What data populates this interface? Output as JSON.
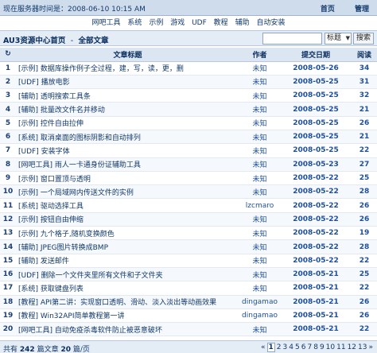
{
  "header": {
    "status_text": "现在服务器时间是：2008-06-10 10:15 AM",
    "home": "首页",
    "admin": "管理"
  },
  "nav": [
    "网吧工具",
    "系统",
    "示例",
    "游戏",
    "UDF",
    "教程",
    "辅助",
    "自动安装"
  ],
  "breadcrumb": {
    "root": "AU3资源中心首页",
    "sep": "-",
    "current": "全部文章"
  },
  "search": {
    "value": "",
    "select_value": "标题",
    "button": "搜索"
  },
  "table": {
    "head_icon": "↻",
    "headers": {
      "title": "文章标题",
      "author": "作者",
      "date": "提交日期",
      "views": "阅读"
    },
    "rows": [
      {
        "n": "1",
        "title": "[示例] 数据库操作例子全过程，建，写，读，更，删",
        "author": "未知",
        "date": "2008-05-26",
        "views": "34"
      },
      {
        "n": "2",
        "title": "[UDF] 播放电影",
        "author": "未知",
        "date": "2008-05-25",
        "views": "31"
      },
      {
        "n": "3",
        "title": "[辅助] 透明搜索工具条",
        "author": "未知",
        "date": "2008-05-25",
        "views": "32"
      },
      {
        "n": "4",
        "title": "[辅助] 批量改文件名并移动",
        "author": "未知",
        "date": "2008-05-25",
        "views": "21"
      },
      {
        "n": "5",
        "title": "[示例] 控件自由拉伸",
        "author": "未知",
        "date": "2008-05-25",
        "views": "26"
      },
      {
        "n": "6",
        "title": "[系统] 取消桌面的图标阴影和自动排列",
        "author": "未知",
        "date": "2008-05-25",
        "views": "21"
      },
      {
        "n": "7",
        "title": "[UDF] 安装字体",
        "author": "未知",
        "date": "2008-05-25",
        "views": "22"
      },
      {
        "n": "8",
        "title": "[网吧工具] 雨人一卡通身份证辅助工具",
        "author": "未知",
        "date": "2008-05-23",
        "views": "27"
      },
      {
        "n": "9",
        "title": "[示例] 窗口置顶与透明",
        "author": "未知",
        "date": "2008-05-22",
        "views": "25"
      },
      {
        "n": "10",
        "title": "[示例] 一个局域网内传送文件的实例",
        "author": "未知",
        "date": "2008-05-22",
        "views": "28"
      },
      {
        "n": "11",
        "title": "[系统] 驱动选择工具",
        "author": "lzcmaro",
        "date": "2008-05-22",
        "views": "26"
      },
      {
        "n": "12",
        "title": "[示例] 按钮自由伸缩",
        "author": "未知",
        "date": "2008-05-22",
        "views": "26"
      },
      {
        "n": "13",
        "title": "[示例] 九个格子,随机变换颜色",
        "author": "未知",
        "date": "2008-05-22",
        "views": "19"
      },
      {
        "n": "14",
        "title": "[辅助] JPEG图片转换成BMP",
        "author": "未知",
        "date": "2008-05-22",
        "views": "28"
      },
      {
        "n": "15",
        "title": "[辅助] 发送邮件",
        "author": "未知",
        "date": "2008-05-22",
        "views": "22"
      },
      {
        "n": "16",
        "title": "[UDF] 删除一个文件夹里所有文件和子文件夹",
        "author": "未知",
        "date": "2008-05-21",
        "views": "25"
      },
      {
        "n": "17",
        "title": "[系统] 获取键盘列表",
        "author": "未知",
        "date": "2008-05-21",
        "views": "22"
      },
      {
        "n": "18",
        "title": "[教程] API第二讲：实现窗口透明、滑动、淡入淡出等动画效果",
        "author": "dingamao",
        "date": "2008-05-21",
        "views": "26"
      },
      {
        "n": "19",
        "title": "[教程] Win32API简单教程第一讲",
        "author": "dingamao",
        "date": "2008-05-21",
        "views": "26"
      },
      {
        "n": "20",
        "title": "[网吧工具] 自动免疫杀毒软件防止被恶意破坏",
        "author": "未知",
        "date": "2008-05-21",
        "views": "22"
      }
    ]
  },
  "footer": {
    "prefix": "共有",
    "total": "242",
    "total_unit": "篇文章",
    "per_page": "20",
    "per_page_unit": "篇/页",
    "pages": [
      "1",
      "2",
      "3",
      "4",
      "5",
      "6",
      "7",
      "8",
      "9",
      "10",
      "11",
      "12",
      "13"
    ],
    "current_page": "1",
    "prev": "«",
    "next": "»"
  }
}
